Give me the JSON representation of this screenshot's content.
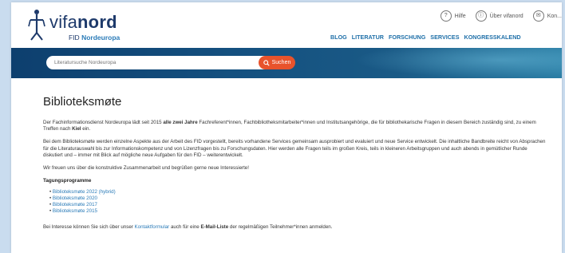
{
  "header": {
    "logo_word_light": "vifa",
    "logo_word_bold": "nord",
    "logo_sub_prefix": "FID ",
    "logo_sub_bold": "Nordeuropa",
    "util": [
      {
        "icon": "?",
        "label": "Hilfe"
      },
      {
        "icon": "ⓘ",
        "label": "Über vifanord"
      },
      {
        "icon": "✉",
        "label": "Kon..."
      }
    ],
    "nav": [
      "BLOG",
      "LITERATUR",
      "FORSCHUNG",
      "SERVICES",
      "KONGRESSKALEND"
    ]
  },
  "search": {
    "placeholder": "Literatursuche Nordeuropa",
    "button_label": "Suchen"
  },
  "main": {
    "title": "Biblioteksmøte",
    "para1_a": "Der Fachinformationsdienst Nordeuropa lädt seit 2015 ",
    "para1_b": "alle zwei Jahre",
    "para1_c": " Fachreferent*innen, Fachbibliotheksmitarbeiter*innen und Institutsangehörige, die für bibliothekarische Fragen in diesem Bereich zuständig sind, zu einem Treffen nach ",
    "para1_d": "Kiel",
    "para1_e": " ein.",
    "para2": "Bei dem Biblioteksmøte werden einzelne Aspekte aus der Arbeit des FID vorgestellt, bereits vorhandene Services gemeinsam ausprobiert und evaluiert und neue Service entwickelt. Die inhaltliche Bandbreite reicht von Absprachen für die Literaturauswahl bis zur Informationskompetenz und von Lizenzfragen bis zu Forschungsdaten. Hier werden alle Fragen teils im großen Kreis, teils in kleineren Arbeitsgruppen und auch abends in gemütlicher Runde diskutiert und – immer mit Blick auf mögliche neue Aufgaben für den FID – weiterentwickelt.",
    "para3": "Wir freuen uns über die konstruktive Zusammenarbeit und begrüßen gerne neue Interessierte!",
    "programme_heading": "Tagungsprogramme",
    "programmes": [
      "Biblioteksmøte 2022 (hybrid)",
      "Biblioteksmøte 2020",
      "Biblioteksmøte 2017",
      "Biblioteksmøte 2015"
    ],
    "footer_a": "Bei Interesse können Sie sich über unser ",
    "footer_link": "Kontaktformular",
    "footer_b": " auch für eine ",
    "footer_bold": "E-Mail-Liste",
    "footer_c": " der regelmäßigen Teilnehmer*innen anmelden."
  },
  "colors": {
    "brand_navy": "#1e3a6b",
    "nav_blue": "#1e6fa8",
    "link_blue": "#2a7bb8",
    "search_orange": "#e8532c",
    "page_bg": "#c9dcef"
  }
}
